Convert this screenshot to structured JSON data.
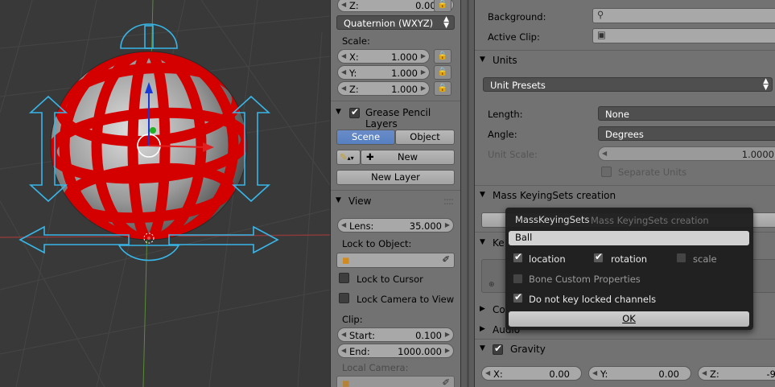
{
  "toolshelf": {
    "z_top": {
      "key": "Z:",
      "value": "0.000"
    },
    "rotation_mode": "Quaternion (WXYZ)",
    "scale_label": "Scale:",
    "scale": [
      {
        "key": "X:",
        "value": "1.000"
      },
      {
        "key": "Y:",
        "value": "1.000"
      },
      {
        "key": "Z:",
        "value": "1.000"
      }
    ],
    "grease_pencil": {
      "title": "Grease Pencil Layers",
      "tab_scene": "Scene",
      "tab_object": "Object",
      "new_label": "New",
      "new_layer_label": "New Layer"
    },
    "view": {
      "title": "View",
      "lens_key": "Lens:",
      "lens_value": "35.000",
      "lock_to_object": "Lock to Object:",
      "lock_to_cursor": "Lock to Cursor",
      "lock_camera": "Lock Camera to View",
      "clip_label": "Clip:",
      "start_key": "Start:",
      "start_value": "0.100",
      "end_key": "End:",
      "end_value": "1000.000",
      "local_camera": "Local Camera:"
    }
  },
  "props": {
    "background_label": "Background:",
    "active_clip_label": "Active Clip:",
    "units": {
      "title": "Units",
      "presets": "Unit Presets",
      "length_label": "Length:",
      "length_value": "None",
      "angle_label": "Angle:",
      "angle_value": "Degrees",
      "unit_scale_label": "Unit Scale:",
      "unit_scale_value": "1.0000",
      "separate_units": "Separate Units"
    },
    "mass_keying": {
      "title": "Mass KeyingSets creation"
    },
    "hidden_headers": [
      "Ke",
      "Co",
      "Audio"
    ],
    "gravity": {
      "title": "Gravity",
      "x_key": "X:",
      "x_value": "0.00",
      "y_key": "Y:",
      "y_value": "0.00",
      "z_key": "Z:",
      "z_value": "-9"
    }
  },
  "popup": {
    "title": "MassKeyingSets",
    "ghost_text": "Mass KeyingSets creation",
    "name_value": "Ball",
    "location": "location",
    "rotation": "rotation",
    "scale": "scale",
    "bone_custom": "Bone Custom Properties",
    "do_not_key": "Do not key locked channels",
    "ok": "OK"
  },
  "colors": {
    "sphere_red": "#d40000",
    "manipulator_cyan": "#38b6e8",
    "panel_gray": "#727272",
    "tab_blue": "#5680c2"
  }
}
